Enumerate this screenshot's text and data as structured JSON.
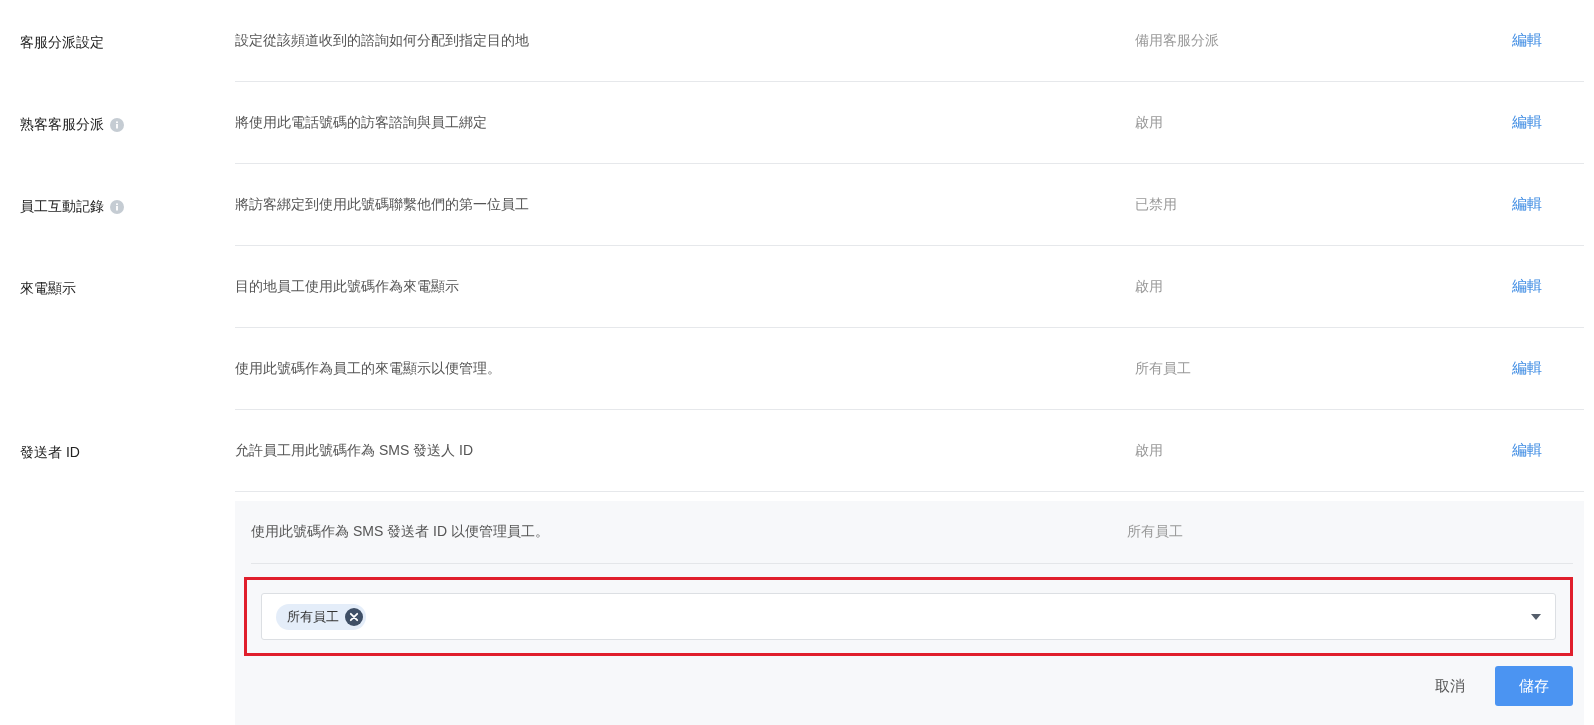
{
  "settings": [
    {
      "label": "客服分派設定",
      "info": false,
      "description": "設定從該頻道收到的諮詢如何分配到指定目的地",
      "value": "備用客服分派",
      "action": "編輯"
    },
    {
      "label": "熟客客服分派",
      "info": true,
      "description": "將使用此電話號碼的訪客諮詢與員工綁定",
      "value": "啟用",
      "action": "編輯"
    },
    {
      "label": "員工互動記錄",
      "info": true,
      "description": "將訪客綁定到使用此號碼聯繫他們的第一位員工",
      "value": "已禁用",
      "action": "編輯"
    },
    {
      "label": "來電顯示",
      "info": false,
      "description": "目的地員工使用此號碼作為來電顯示",
      "value": "啟用",
      "action": "編輯"
    },
    {
      "info": false,
      "description": "使用此號碼作為員工的來電顯示以便管理。",
      "value": "所有員工",
      "action": "編輯"
    },
    {
      "label": "發送者 ID",
      "info": false,
      "description": "允許員工用此號碼作為 SMS 發送人 ID",
      "value": "啟用",
      "action": "編輯"
    }
  ],
  "edit_panel": {
    "description": "使用此號碼作為 SMS 發送者 ID 以便管理員工。",
    "value": "所有員工",
    "highlighted": true,
    "select": {
      "tags": [
        {
          "label": "所有員工"
        }
      ]
    },
    "buttons": [
      {
        "label": "取消",
        "kind": "text"
      },
      {
        "label": "儲存",
        "kind": "primary"
      }
    ]
  }
}
